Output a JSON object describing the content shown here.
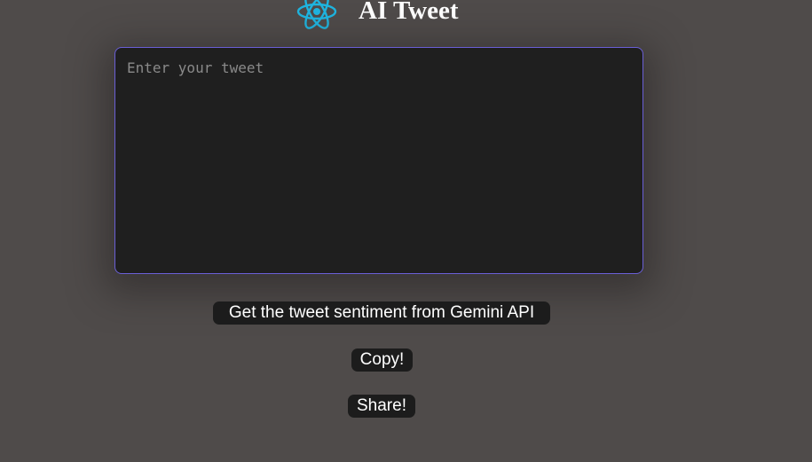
{
  "header": {
    "title": "AI Tweet",
    "logo_icon": "react-atom-icon",
    "logo_color": "#1fb5e0"
  },
  "tweet_input": {
    "placeholder": "Enter your tweet",
    "value": "",
    "border_color": "#6a5fd6"
  },
  "actions": {
    "sentiment_label": "Get the tweet sentiment from Gemini API",
    "copy_label": "Copy!",
    "share_label": "Share!"
  }
}
